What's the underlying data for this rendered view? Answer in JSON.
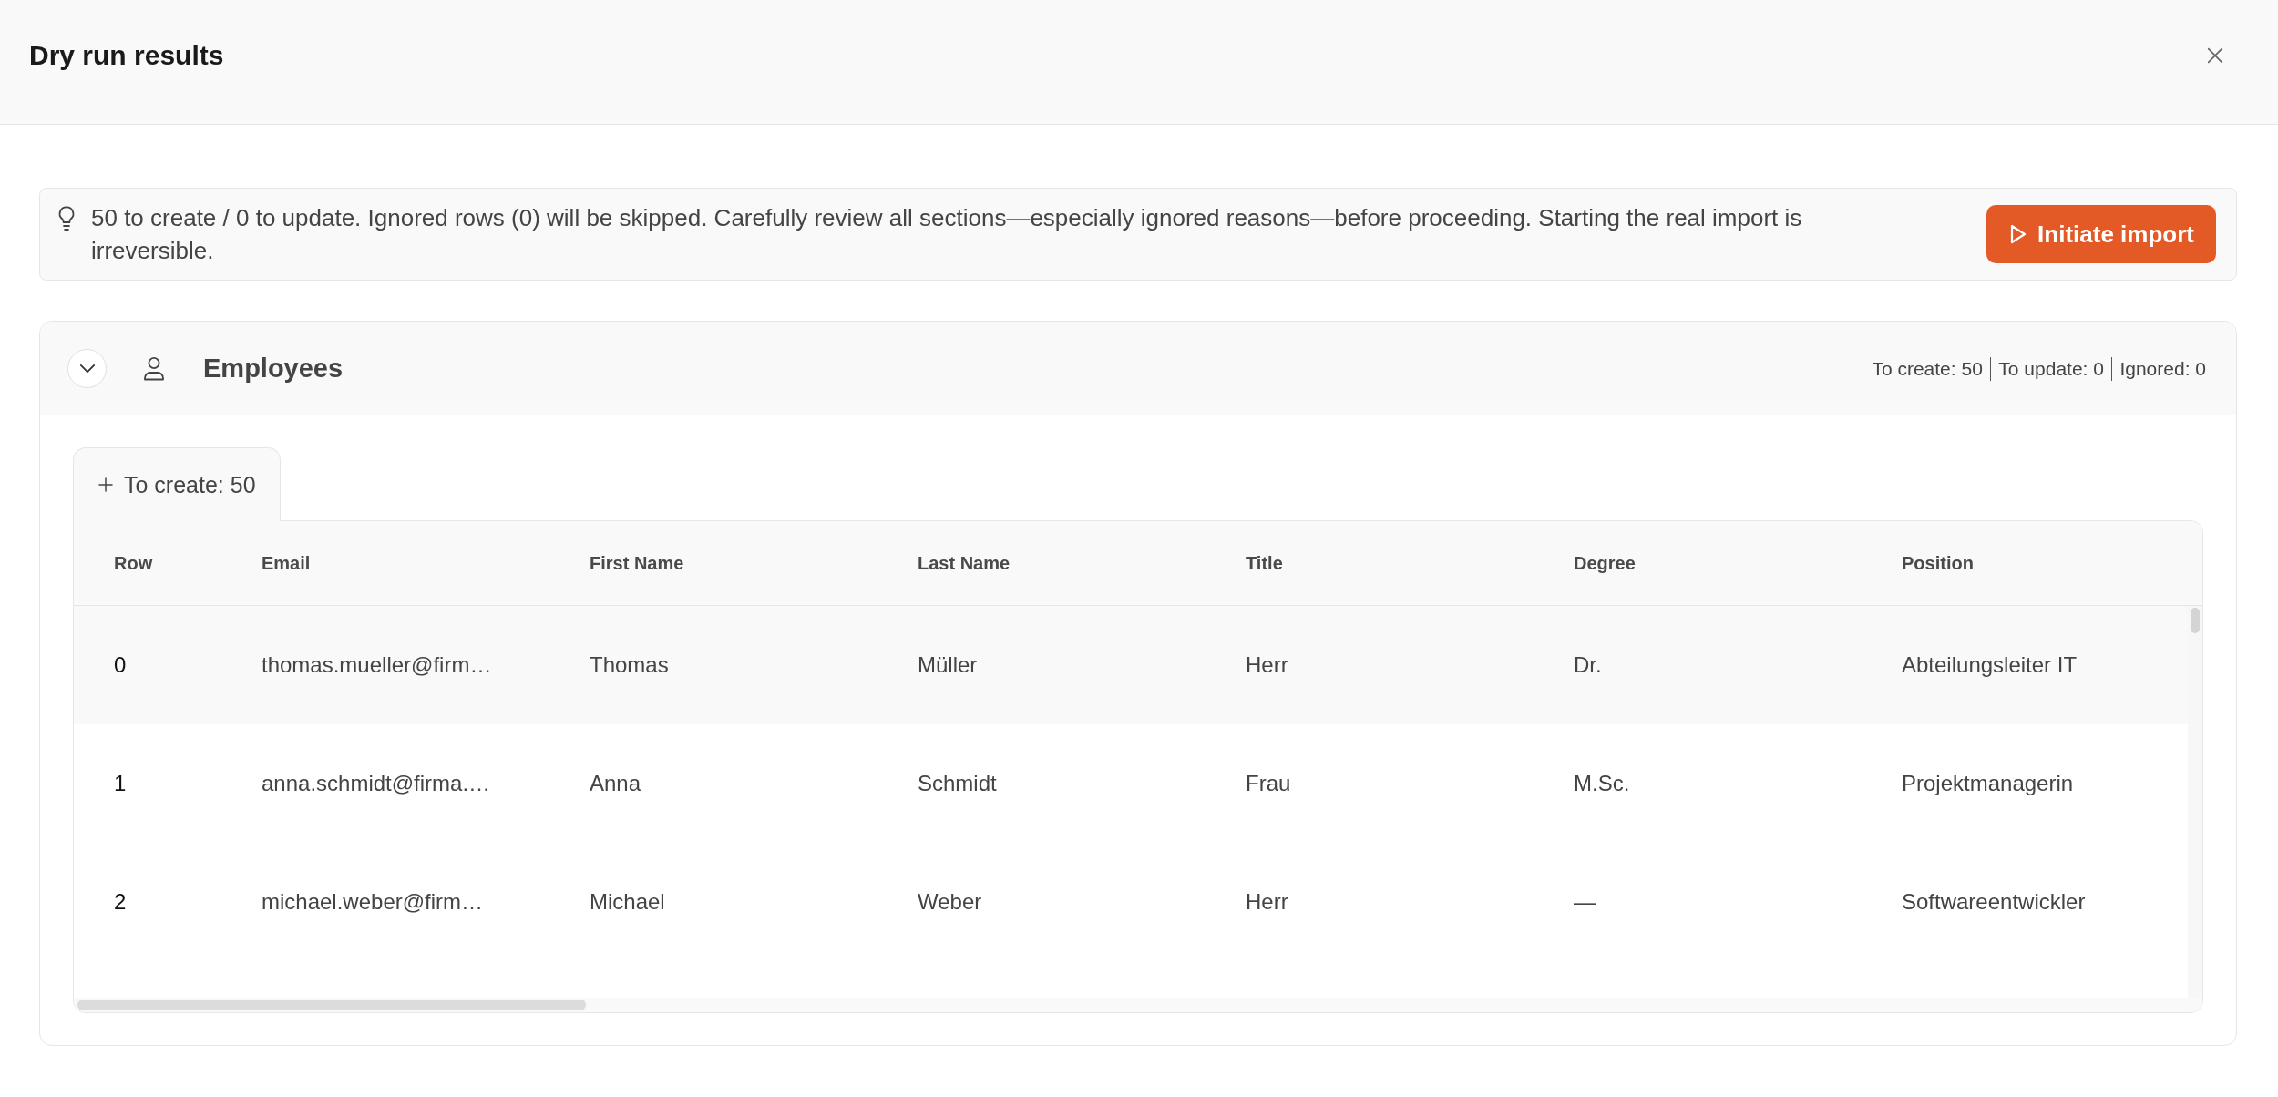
{
  "dialog": {
    "title": "Dry run results"
  },
  "notice": {
    "text": "50 to create / 0 to update. Ignored rows (0) will be skipped. Carefully review all sections—especially ignored reasons—before proceeding. Starting the real import is irreversible.",
    "button": "Initiate import"
  },
  "sections": [
    {
      "title": "Employees",
      "expanded": true,
      "summary": [
        "To create: 50",
        "To update: 0",
        "Ignored: 0"
      ],
      "tabs": [
        {
          "label": "To create: 50",
          "selected": true
        }
      ],
      "table": {
        "columns": [
          "Row",
          "Email",
          "First Name",
          "Last Name",
          "Title",
          "Degree",
          "Position"
        ],
        "rows": [
          {
            "highlighted": true,
            "cells": [
              "0",
              "thomas.mueller@firm…",
              "Thomas",
              "Müller",
              "Herr",
              "Dr.",
              "Abteilungsleiter IT"
            ]
          },
          {
            "highlighted": false,
            "cells": [
              "1",
              "anna.schmidt@firma.…",
              "Anna",
              "Schmidt",
              "Frau",
              "M.Sc.",
              "Projektmanagerin"
            ]
          },
          {
            "highlighted": false,
            "cells": [
              "2",
              "michael.weber@firm…",
              "Michael",
              "Weber",
              "Herr",
              "—",
              "Softwareentwickler"
            ]
          }
        ]
      }
    }
  ]
}
